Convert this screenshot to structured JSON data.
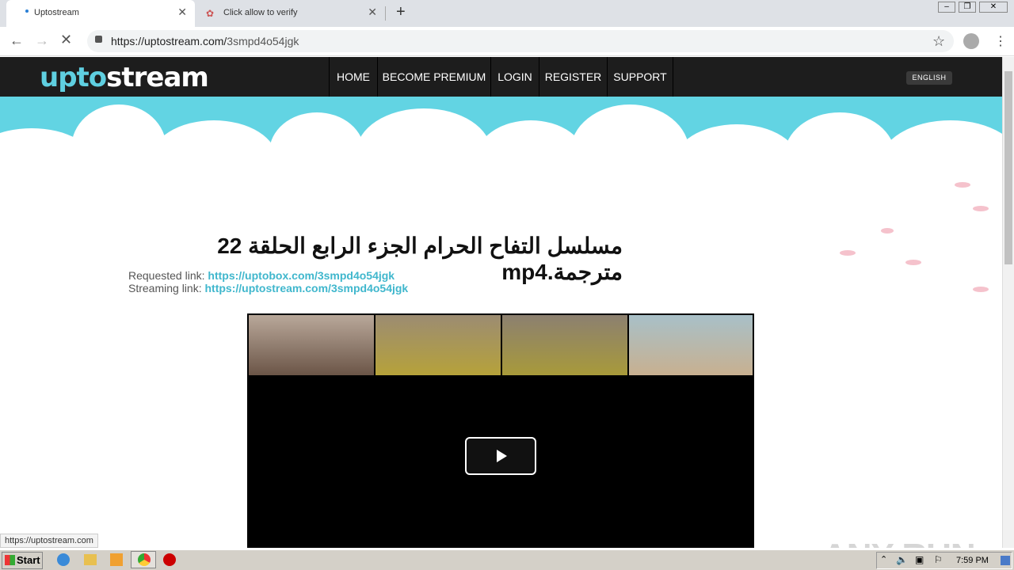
{
  "browser": {
    "tabs": [
      {
        "label": "Uptostream",
        "active": true
      },
      {
        "label": "Click allow to verify",
        "active": false
      }
    ],
    "url_host": "https://uptostream.com/",
    "url_path": "3smpd4o54jgk"
  },
  "site": {
    "logo": "uptostream",
    "nav": [
      "HOME",
      "BECOME PREMIUM",
      "LOGIN",
      "REGISTER",
      "SUPPORT"
    ],
    "lang": "ENGLISH",
    "title": "مسلسل التفاح الحرام الجزء الرابع الحلقة 22 مترجمة.mp4",
    "requested_label": "Requested link:",
    "requested_url": "https://uptobox.com/3smpd4o54jgk",
    "streaming_label": "Streaming link:",
    "streaming_url": "https://uptostream.com/3smpd4o54jgk"
  },
  "status_url": "https://uptostream.com",
  "taskbar": {
    "start": "Start",
    "clock": "7:59 PM"
  },
  "watermark": "ANY RUN",
  "colors": {
    "accent": "#40b7cd",
    "nav_bg": "#1d1d1d",
    "sky": "#62d4e3"
  }
}
